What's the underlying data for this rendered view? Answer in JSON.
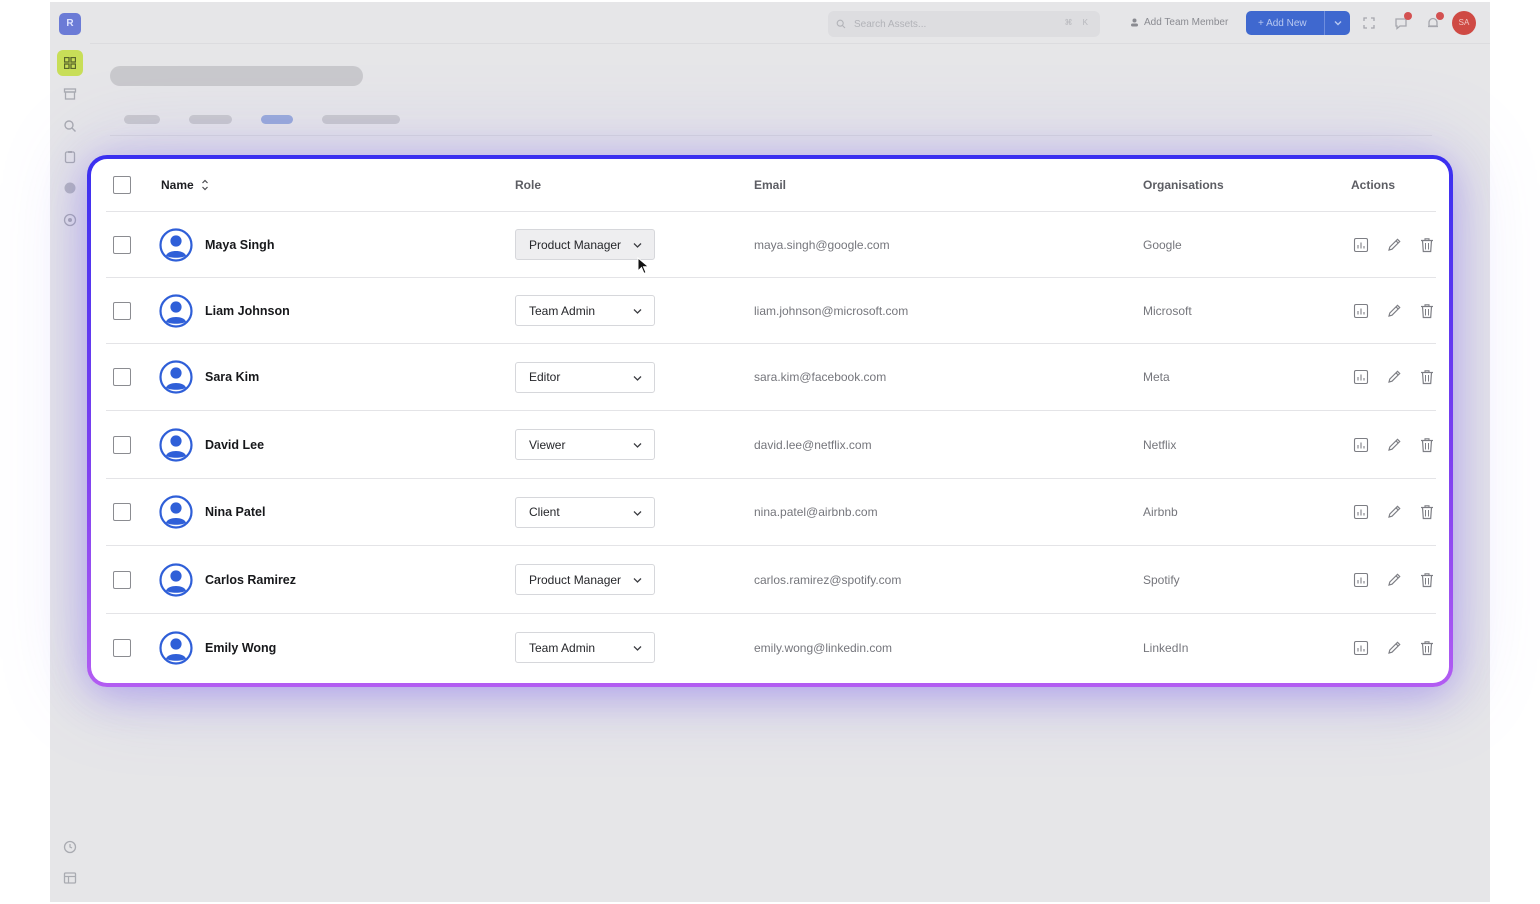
{
  "sidebar": {
    "logo": "R",
    "icons": [
      "grid-icon",
      "archive-icon",
      "search-icon",
      "clipboard-icon",
      "globe-icon",
      "help-icon",
      "clock-icon",
      "layout-icon"
    ]
  },
  "topbar": {
    "search_placeholder": "Search Assets...",
    "search_shortcut": "⌘ K",
    "add_team_member": "Add Team Member",
    "add_new": "+ Add New",
    "avatar_initials": "SA"
  },
  "table": {
    "headers": {
      "name": "Name",
      "role": "Role",
      "email": "Email",
      "organisations": "Organisations",
      "actions": "Actions"
    },
    "rows": [
      {
        "name": "Maya Singh",
        "role": "Product Manager",
        "email": "maya.singh@google.com",
        "org": "Google"
      },
      {
        "name": "Liam Johnson",
        "role": "Team Admin",
        "email": "liam.johnson@microsoft.com",
        "org": "Microsoft"
      },
      {
        "name": "Sara Kim",
        "role": "Editor",
        "email": "sara.kim@facebook.com",
        "org": "Meta"
      },
      {
        "name": "David Lee",
        "role": "Viewer",
        "email": "david.lee@netflix.com",
        "org": "Netflix"
      },
      {
        "name": "Nina Patel",
        "role": "Client",
        "email": "nina.patel@airbnb.com",
        "org": "Airbnb"
      },
      {
        "name": "Carlos Ramirez",
        "role": "Product Manager",
        "email": "carlos.ramirez@spotify.com",
        "org": "Spotify"
      },
      {
        "name": "Emily Wong",
        "role": "Team Admin",
        "email": "emily.wong@linkedin.com",
        "org": "LinkedIn"
      }
    ]
  },
  "colors": {
    "accent": "#3f68cf",
    "card_border_top": "#3a2ff0",
    "card_border_bottom": "#b25cf2",
    "user_icon": "#2f5fd8",
    "active_sidebar": "#c8de58"
  }
}
